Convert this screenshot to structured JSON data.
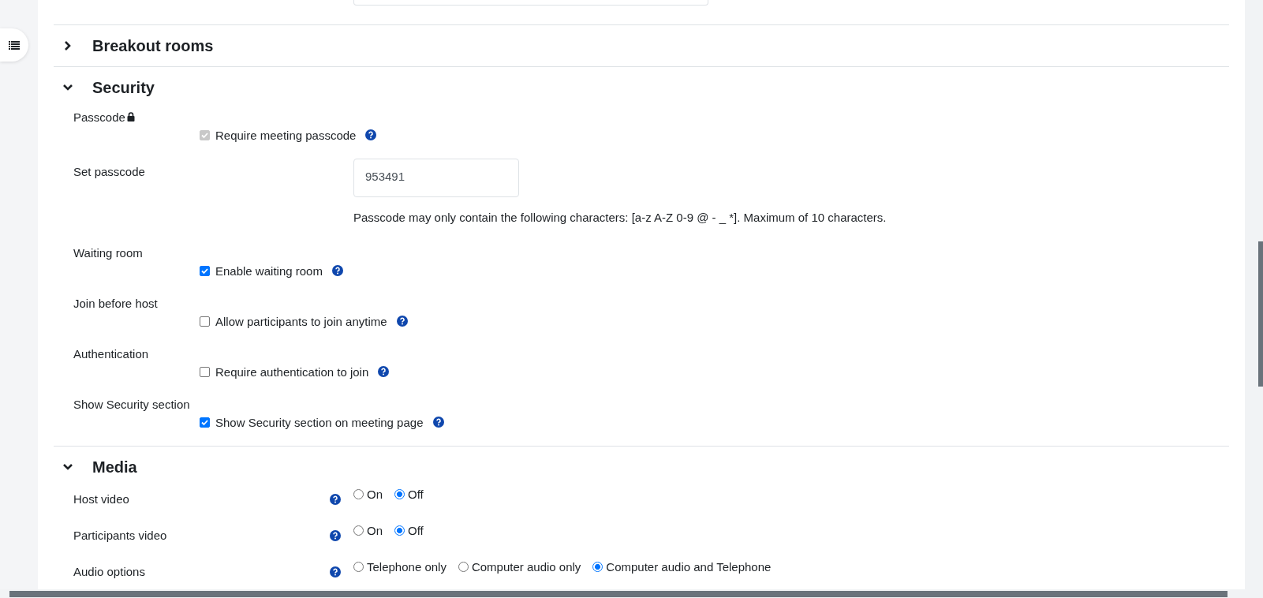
{
  "sections": [
    {
      "title": "Breakout rooms",
      "expanded": false
    },
    {
      "title": "Security",
      "expanded": true,
      "rows": [
        {
          "kind": "checkbox",
          "label": "Passcode",
          "locked": true,
          "option": "Require meeting passcode",
          "checked": true,
          "disabled": true,
          "help": true
        },
        {
          "kind": "text",
          "label": "Set passcode",
          "value": "953491",
          "note": "Passcode may only contain the following characters: [a-z A-Z 0-9 @ - _ *]. Maximum of 10 characters."
        },
        {
          "kind": "checkbox",
          "label": "Waiting room",
          "locked": false,
          "option": "Enable waiting room",
          "checked": true,
          "disabled": false,
          "help": true
        },
        {
          "kind": "checkbox",
          "label": "Join before host",
          "locked": false,
          "option": "Allow participants to join anytime",
          "checked": false,
          "disabled": false,
          "help": true
        },
        {
          "kind": "checkbox",
          "label": "Authentication",
          "locked": false,
          "option": "Require authentication to join",
          "checked": false,
          "disabled": false,
          "help": true
        },
        {
          "kind": "checkbox",
          "label": "Show Security section",
          "locked": false,
          "option": "Show Security section on meeting page",
          "checked": true,
          "disabled": false,
          "help": true
        }
      ]
    },
    {
      "title": "Media",
      "expanded": true,
      "rows": [
        {
          "kind": "radio",
          "label": "Host video",
          "help": true,
          "options": [
            {
              "label": "On",
              "selected": false
            },
            {
              "label": "Off",
              "selected": true
            }
          ]
        },
        {
          "kind": "radio",
          "label": "Participants video",
          "help": true,
          "options": [
            {
              "label": "On",
              "selected": false
            },
            {
              "label": "Off",
              "selected": true
            }
          ]
        },
        {
          "kind": "radio",
          "label": "Audio options",
          "help": true,
          "options": [
            {
              "label": "Telephone only",
              "selected": false
            },
            {
              "label": "Computer audio only",
              "selected": false
            },
            {
              "label": "Computer audio and Telephone",
              "selected": true
            }
          ]
        }
      ]
    }
  ]
}
